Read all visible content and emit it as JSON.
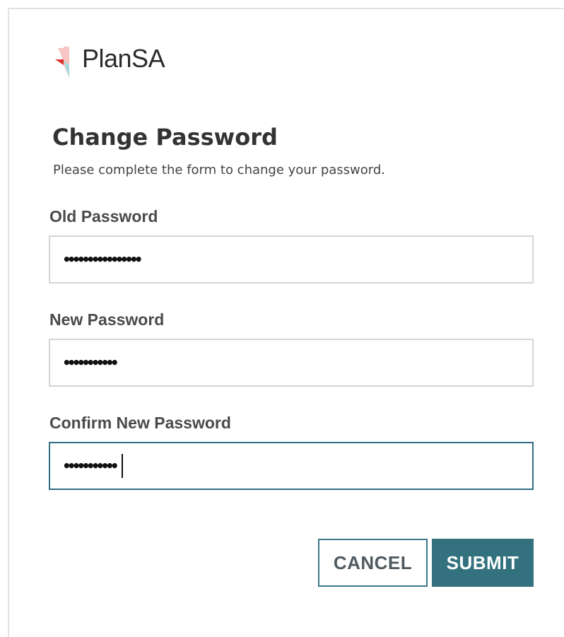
{
  "brand": {
    "name": "PlanSA",
    "colors": {
      "red": "#e0322d",
      "pink": "#f7c6c4",
      "teal": "#9fdcdc"
    }
  },
  "form": {
    "title": "Change Password",
    "subtitle": "Please complete the form to change your password.",
    "fields": [
      {
        "label": "Old Password",
        "masked_value": "••••••••••••••••",
        "focused": false
      },
      {
        "label": "New Password",
        "masked_value": "•••••••••••",
        "focused": false
      },
      {
        "label": "Confirm New Password",
        "masked_value": "•••••••••••",
        "focused": true
      }
    ]
  },
  "actions": {
    "cancel_label": "CANCEL",
    "submit_label": "SUBMIT"
  },
  "theme": {
    "accent": "#33717f",
    "input_border": "#d4d4d4",
    "focus_border": "#2e6e82"
  }
}
